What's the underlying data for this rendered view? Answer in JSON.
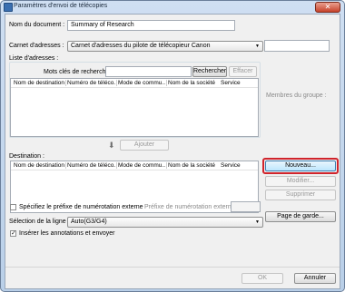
{
  "window": {
    "title": "Paramètres d'envoi de télécopies",
    "close_glyph": "✕"
  },
  "form": {
    "doc_name_label": "Nom du document :",
    "doc_name_value": "Summary of Research",
    "address_book_label": "Carnet d'adresses :",
    "address_book_value": "Carnet d'adresses du pilote de télécopieur Canon",
    "address_list_label": "Liste d'adresses :",
    "search_keyword_label": "Mots clés de recherche",
    "search_button": "Rechercher",
    "clear_button": "Effacer",
    "group_members_label": "Membres du groupe :",
    "add_button": "Ajouter",
    "destination_label": "Destination :",
    "new_button": "Nouveau...",
    "modify_button": "Modifier...",
    "delete_button": "Supprimer",
    "cover_page_button": "Page de garde...",
    "dial_prefix_checkbox_label": "Spécifiez le préfixe de numérotation externe",
    "dial_prefix_field_label": "Préfixe de numérotation externe :",
    "line_select_label": "Sélection de la ligne :",
    "line_select_value": "Auto(G3/G4)",
    "insert_annotations_label": "Insérer les annotations et envoyer",
    "ok_button": "OK",
    "cancel_button": "Annuler"
  },
  "table_columns": [
    "Nom de destination",
    "Numéro de téléco...",
    "Mode de commu...",
    "Nom de la société",
    "Service"
  ],
  "checkboxes": {
    "dial_prefix": false,
    "insert_annotations": true
  },
  "icons": {
    "add_arrow": "down-arrow-icon",
    "dropdown": "chevron-down-icon"
  },
  "colors": {
    "highlight_ring": "#d0242c",
    "title_bar": "#b9cfe8"
  }
}
